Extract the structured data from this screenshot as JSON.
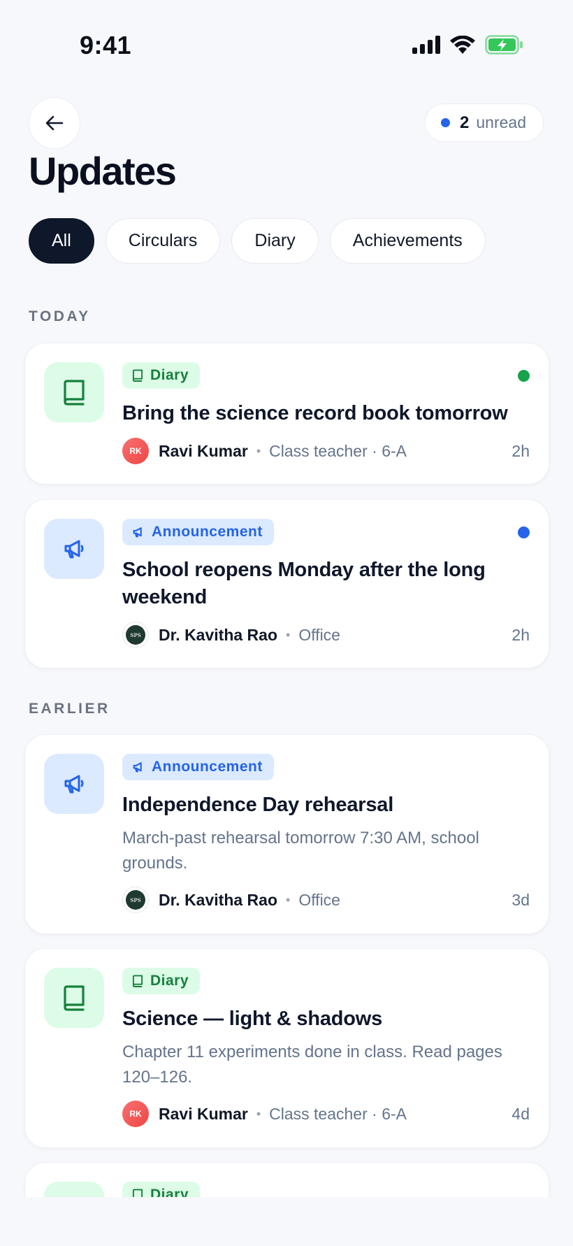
{
  "status_bar": {
    "time": "9:41"
  },
  "header": {
    "title": "Updates",
    "unread_count": "2",
    "unread_label": "unread"
  },
  "filters": [
    "All",
    "Circulars",
    "Diary",
    "Achievements"
  ],
  "sections": {
    "today": "TODAY",
    "earlier": "EARLIER"
  },
  "cards": [
    {
      "tag": "Diary",
      "title": "Bring the science record book tomorrow",
      "description": "",
      "author": "Ravi Kumar",
      "avatar": "RK",
      "role": "Class teacher · 6-A",
      "time": "2h",
      "unread_color": "#16a34a",
      "icon": "book-icon"
    },
    {
      "tag": "Announcement",
      "title": "School reopens Monday after the long weekend",
      "description": "",
      "author": "Dr. Kavitha Rao",
      "avatar": "SPS",
      "role": "Office",
      "time": "2h",
      "unread_color": "#2563eb",
      "icon": "megaphone-icon"
    },
    {
      "tag": "Announcement",
      "title": "Independence Day rehearsal",
      "description": "March-past rehearsal tomorrow 7:30 AM, school grounds.",
      "author": "Dr. Kavitha Rao",
      "avatar": "SPS",
      "role": "Office",
      "time": "3d",
      "icon": "megaphone-icon"
    },
    {
      "tag": "Diary",
      "title": "Science — light & shadows",
      "description": "Chapter 11 experiments done in class. Read pages 120–126.",
      "author": "Ravi Kumar",
      "avatar": "RK",
      "role": "Class teacher · 6-A",
      "time": "4d",
      "icon": "book-icon"
    },
    {
      "tag": "Diary",
      "icon": "book-icon"
    }
  ],
  "colors": {
    "accent_blue": "#2563eb",
    "accent_green": "#16a34a",
    "ink": "#0f172a"
  }
}
